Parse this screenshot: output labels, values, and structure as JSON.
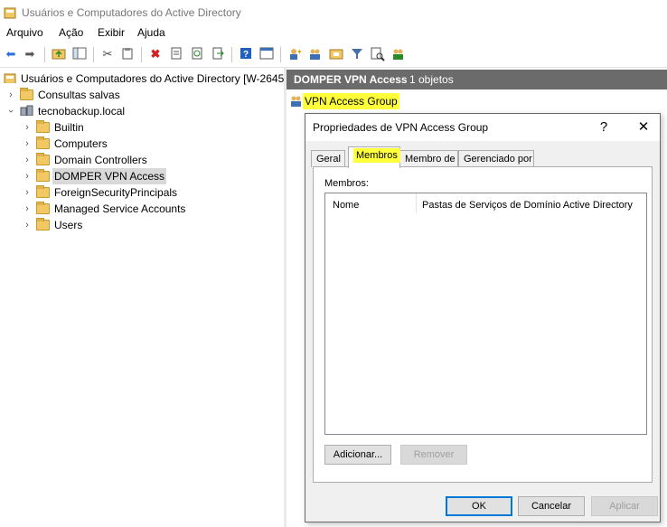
{
  "window": {
    "title": "Usuários e Computadores do Active Directory"
  },
  "menu": [
    "Arquivo",
    "Ação",
    "Exibir",
    "Ajuda"
  ],
  "toolbar": [
    "back-icon",
    "forward-icon",
    "up-folder-icon",
    "show-pane-icon",
    "cut-icon",
    "paste-icon",
    "delete-icon",
    "properties-icon",
    "refresh-icon",
    "export-icon",
    "help-icon",
    "console-icon",
    "new-user-icon",
    "new-group-icon",
    "new-ou-icon",
    "filter-icon",
    "find-icon",
    "add-to-group-icon"
  ],
  "tree": {
    "root": "Usuários e Computadores do Active Directory [W-2645",
    "saved": "Consultas salvas",
    "domain": "tecnobackup.local",
    "children": [
      "Builtin",
      "Computers",
      "Domain Controllers",
      "DOMPER VPN Access",
      "ForeignSecurityPrincipals",
      "Managed Service Accounts",
      "Users"
    ],
    "selected": "DOMPER VPN Access"
  },
  "right": {
    "header_title": "DOMPER VPN Access",
    "header_count": "1 objetos",
    "item": "VPN Access Group"
  },
  "dialog": {
    "title": "Propriedades de VPN Access Group",
    "help": "?",
    "close": "✕",
    "tabs": [
      "Geral",
      "Membros",
      "Membro de",
      "Gerenciado por"
    ],
    "active_tab": "Membros",
    "members_label": "Membros:",
    "columns": [
      "Nome",
      "Pastas de Serviços de Domínio Active Directory"
    ],
    "add": "Adicionar...",
    "remove": "Remover",
    "ok": "OK",
    "cancel": "Cancelar",
    "apply": "Aplicar"
  },
  "colors": {
    "highlight": "#ffff3a",
    "header_bg": "#6b6b6b",
    "accent": "#0078d7"
  }
}
